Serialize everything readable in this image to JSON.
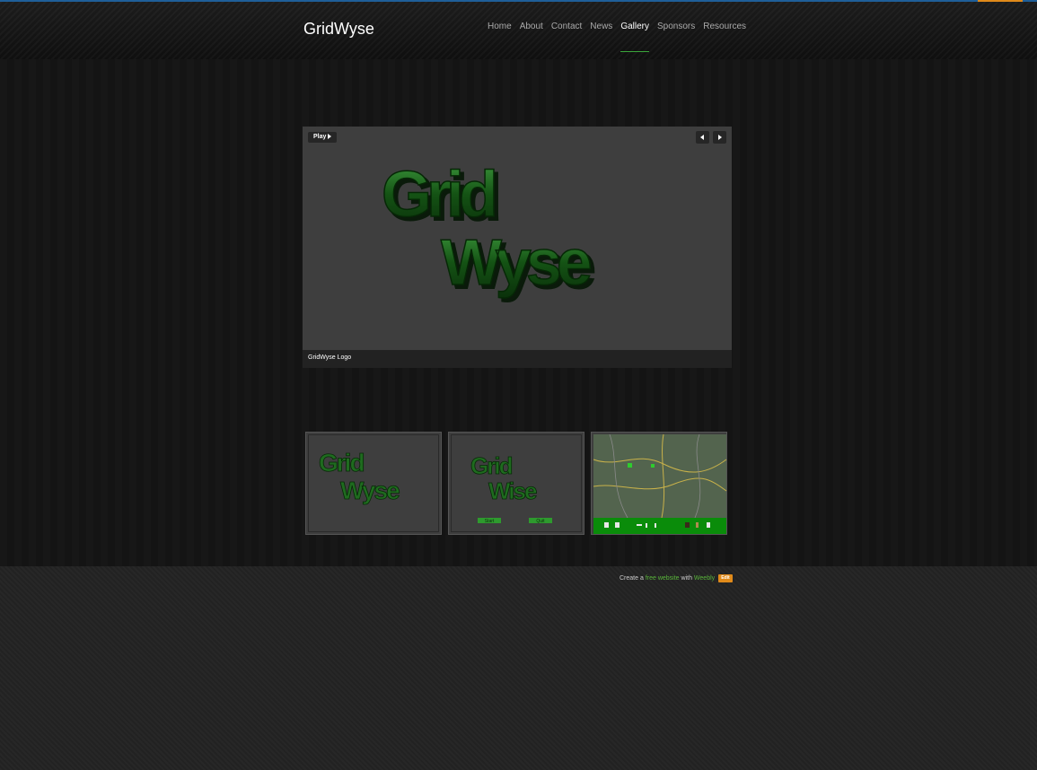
{
  "site": {
    "title": "GridWyse",
    "nav": [
      {
        "label": "Home",
        "active": false
      },
      {
        "label": "About",
        "active": false
      },
      {
        "label": "Contact",
        "active": false
      },
      {
        "label": "News",
        "active": false
      },
      {
        "label": "Gallery",
        "active": true
      },
      {
        "label": "Sponsors",
        "active": false
      },
      {
        "label": "Resources",
        "active": false
      }
    ]
  },
  "slideshow": {
    "play_label": "Play",
    "caption": "GridWyse Logo",
    "logo_text_line1": "Grid",
    "logo_text_line2": "Wyse"
  },
  "thumbnails": [
    {
      "line1": "Grid",
      "line2": "Wyse"
    },
    {
      "line1": "Grid",
      "line2": "Wise",
      "button1": "Start",
      "button2": "Quit"
    },
    {
      "type": "map"
    }
  ],
  "footer": {
    "prefix": "Create a",
    "link1": "free website",
    "middle": "with",
    "link2": "Weebly",
    "edit_label": "Edit"
  },
  "colors": {
    "accent_green": "#3aa53a",
    "logo_green": "#1f6b1f",
    "edit_orange": "#e08a1a",
    "top_blue": "#1f5f99"
  }
}
